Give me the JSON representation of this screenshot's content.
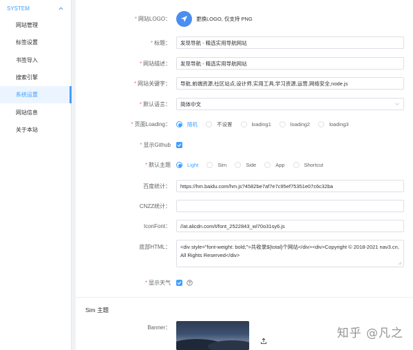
{
  "sidebar": {
    "header": "SYSTEM",
    "items": [
      {
        "label": "网站管理"
      },
      {
        "label": "标签设置"
      },
      {
        "label": "书签导入"
      },
      {
        "label": "搜索引擎"
      },
      {
        "label": "系统设置"
      },
      {
        "label": "网站信息"
      },
      {
        "label": "关于本站"
      }
    ],
    "active_index": 4
  },
  "form": {
    "required_mark": "*",
    "logo": {
      "label": "网站LOGO：",
      "hint": "更换LOGO, 仅支持 PNG"
    },
    "title": {
      "label": "标题：",
      "value": "发现导航 - 精选实用导航网站"
    },
    "description": {
      "label": "网站描述：",
      "value": "发现导航 - 精选实用导航网站"
    },
    "keywords": {
      "label": "网站关键字：",
      "value": "导航,前端资源,社区站点,设计师,实用工具,学习资源,运营,网络安全,node.js"
    },
    "language": {
      "label": "默认语言：",
      "value": "简体中文"
    },
    "loading": {
      "label": "页面Loading：",
      "options": [
        "随机",
        "不设置",
        "loading1",
        "loading2",
        "loading3"
      ],
      "selected": 0
    },
    "github": {
      "label": "显示Github",
      "checked": true
    },
    "theme": {
      "label": "默认主题",
      "options": [
        "Light",
        "Sim",
        "Side",
        "App",
        "Shortcut"
      ],
      "selected": 0
    },
    "baidu": {
      "label": "百度统计：",
      "value": "https://hm.baidu.com/hm.js?4582be7af7e7c95ef75351e07c6c32ba"
    },
    "cnzz": {
      "label": "CNZZ统计：",
      "value": ""
    },
    "iconfont": {
      "label": "IconFont：",
      "value": "//at.alicdn.com/t/font_2522843_wl70o31sy6.js"
    },
    "footer": {
      "label": "底部HTML：",
      "value": "<div style=\"font-weight: bold;\">共收录${total}个网站</div><div>Copyright © 2018-2021 nav3.cn, All Rights Reserved</div>"
    },
    "weather": {
      "label": "显示天气",
      "checked": true
    }
  },
  "sim_section": {
    "title": "Sim 主题",
    "banner_label": "Banner："
  },
  "watermark": "知乎 @凡之",
  "colors": {
    "primary": "#409eff",
    "required": "#f56c6c"
  }
}
